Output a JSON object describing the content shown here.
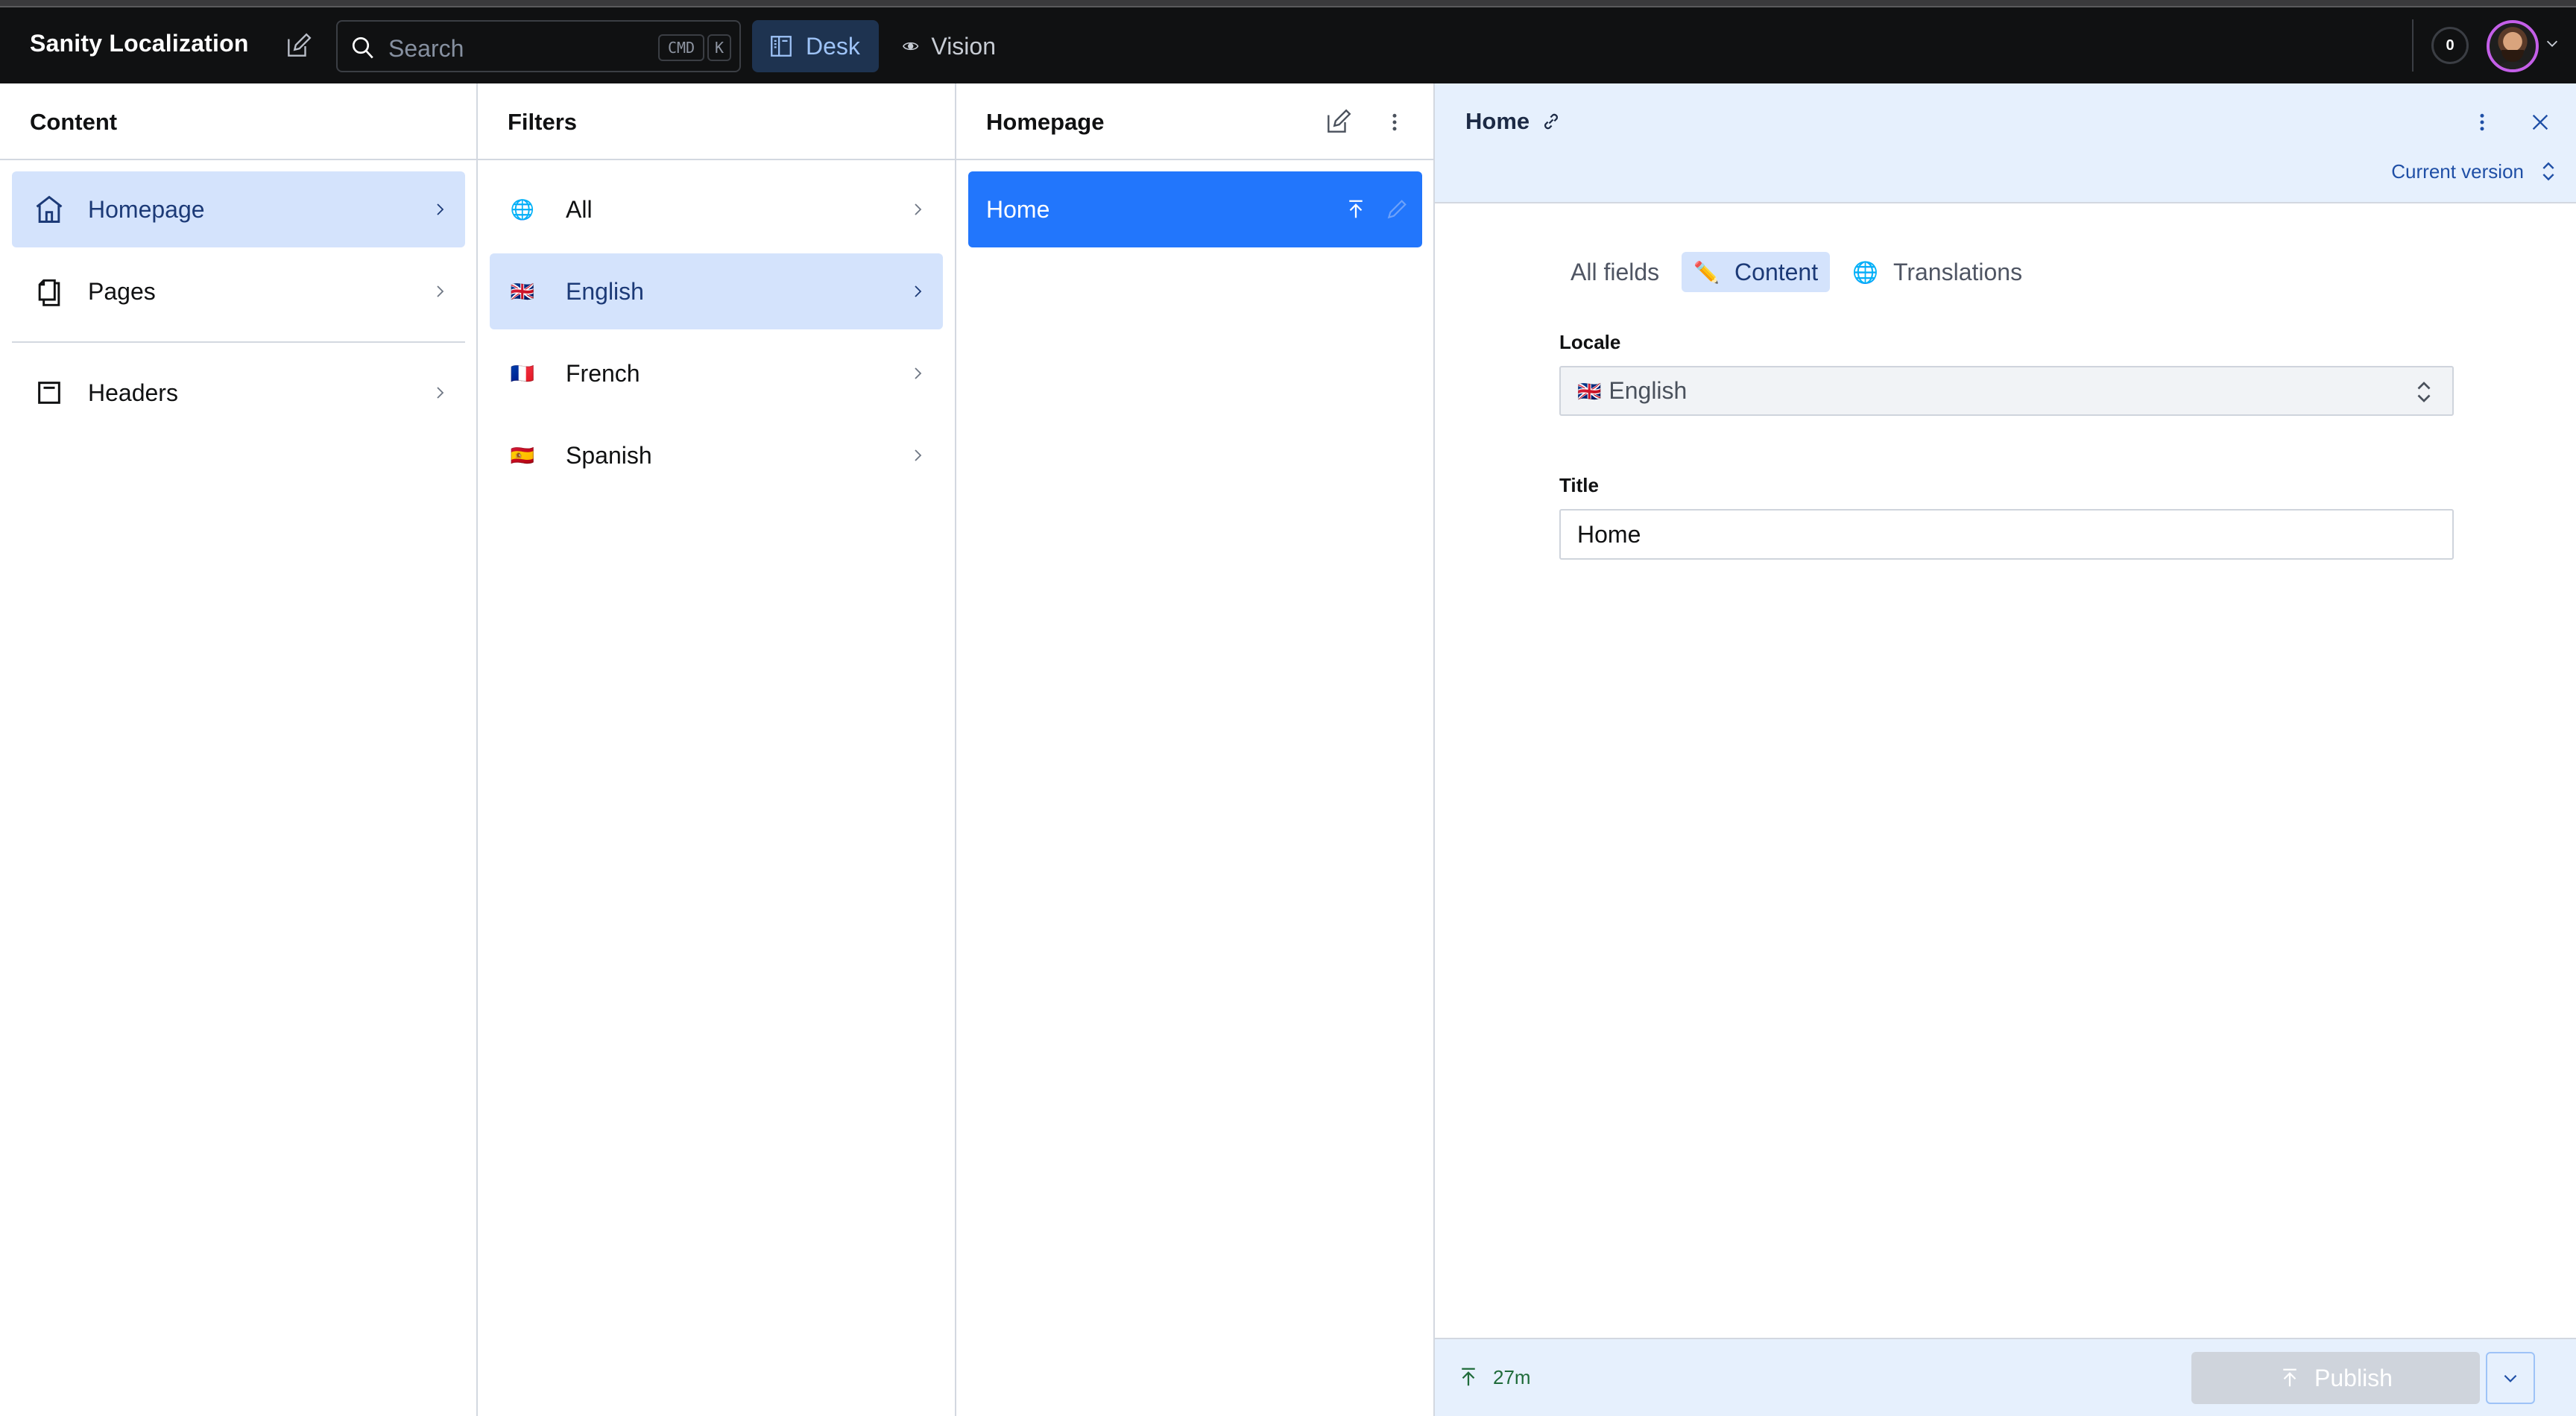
{
  "app": {
    "title": "Sanity Localization",
    "search": {
      "placeholder": "Search",
      "shortcut_keys": [
        "CMD",
        "K"
      ]
    },
    "tools": [
      {
        "label": "Desk",
        "icon": "desk-icon",
        "active": true
      },
      {
        "label": "Vision",
        "icon": "eye-icon",
        "active": false
      }
    ],
    "notifications_count": "0",
    "accent_color": "#2276fc",
    "avatar_ring_color": "#c45fe8"
  },
  "panes": {
    "content": {
      "title": "Content",
      "items": [
        {
          "label": "Homepage",
          "icon": "home-icon",
          "active": true
        },
        {
          "label": "Pages",
          "icon": "documents-icon",
          "active": false
        },
        {
          "label": "Headers",
          "icon": "window-icon",
          "active": false
        }
      ]
    },
    "filters": {
      "title": "Filters",
      "items": [
        {
          "label": "All",
          "icon": "🌐",
          "active": false
        },
        {
          "label": "English",
          "icon": "🇬🇧",
          "active": true
        },
        {
          "label": "French",
          "icon": "🇫🇷",
          "active": false
        },
        {
          "label": "Spanish",
          "icon": "🇪🇸",
          "active": false
        }
      ]
    },
    "documents": {
      "title": "Homepage",
      "items": [
        {
          "label": "Home",
          "selected": true,
          "status": [
            "published",
            "edited"
          ]
        }
      ]
    }
  },
  "editor": {
    "title": "Home",
    "version": "Current version",
    "tabs": [
      {
        "label": "All fields",
        "icon": "",
        "active": false
      },
      {
        "label": "Content",
        "icon": "✏️",
        "active": true
      },
      {
        "label": "Translations",
        "icon": "🌐",
        "active": false
      }
    ],
    "fields": {
      "locale": {
        "label": "Locale",
        "value": "English",
        "flag": "🇬🇧"
      },
      "title": {
        "label": "Title",
        "value": "Home"
      }
    },
    "footer": {
      "published_ago": "27m",
      "publish_label": "Publish"
    }
  }
}
